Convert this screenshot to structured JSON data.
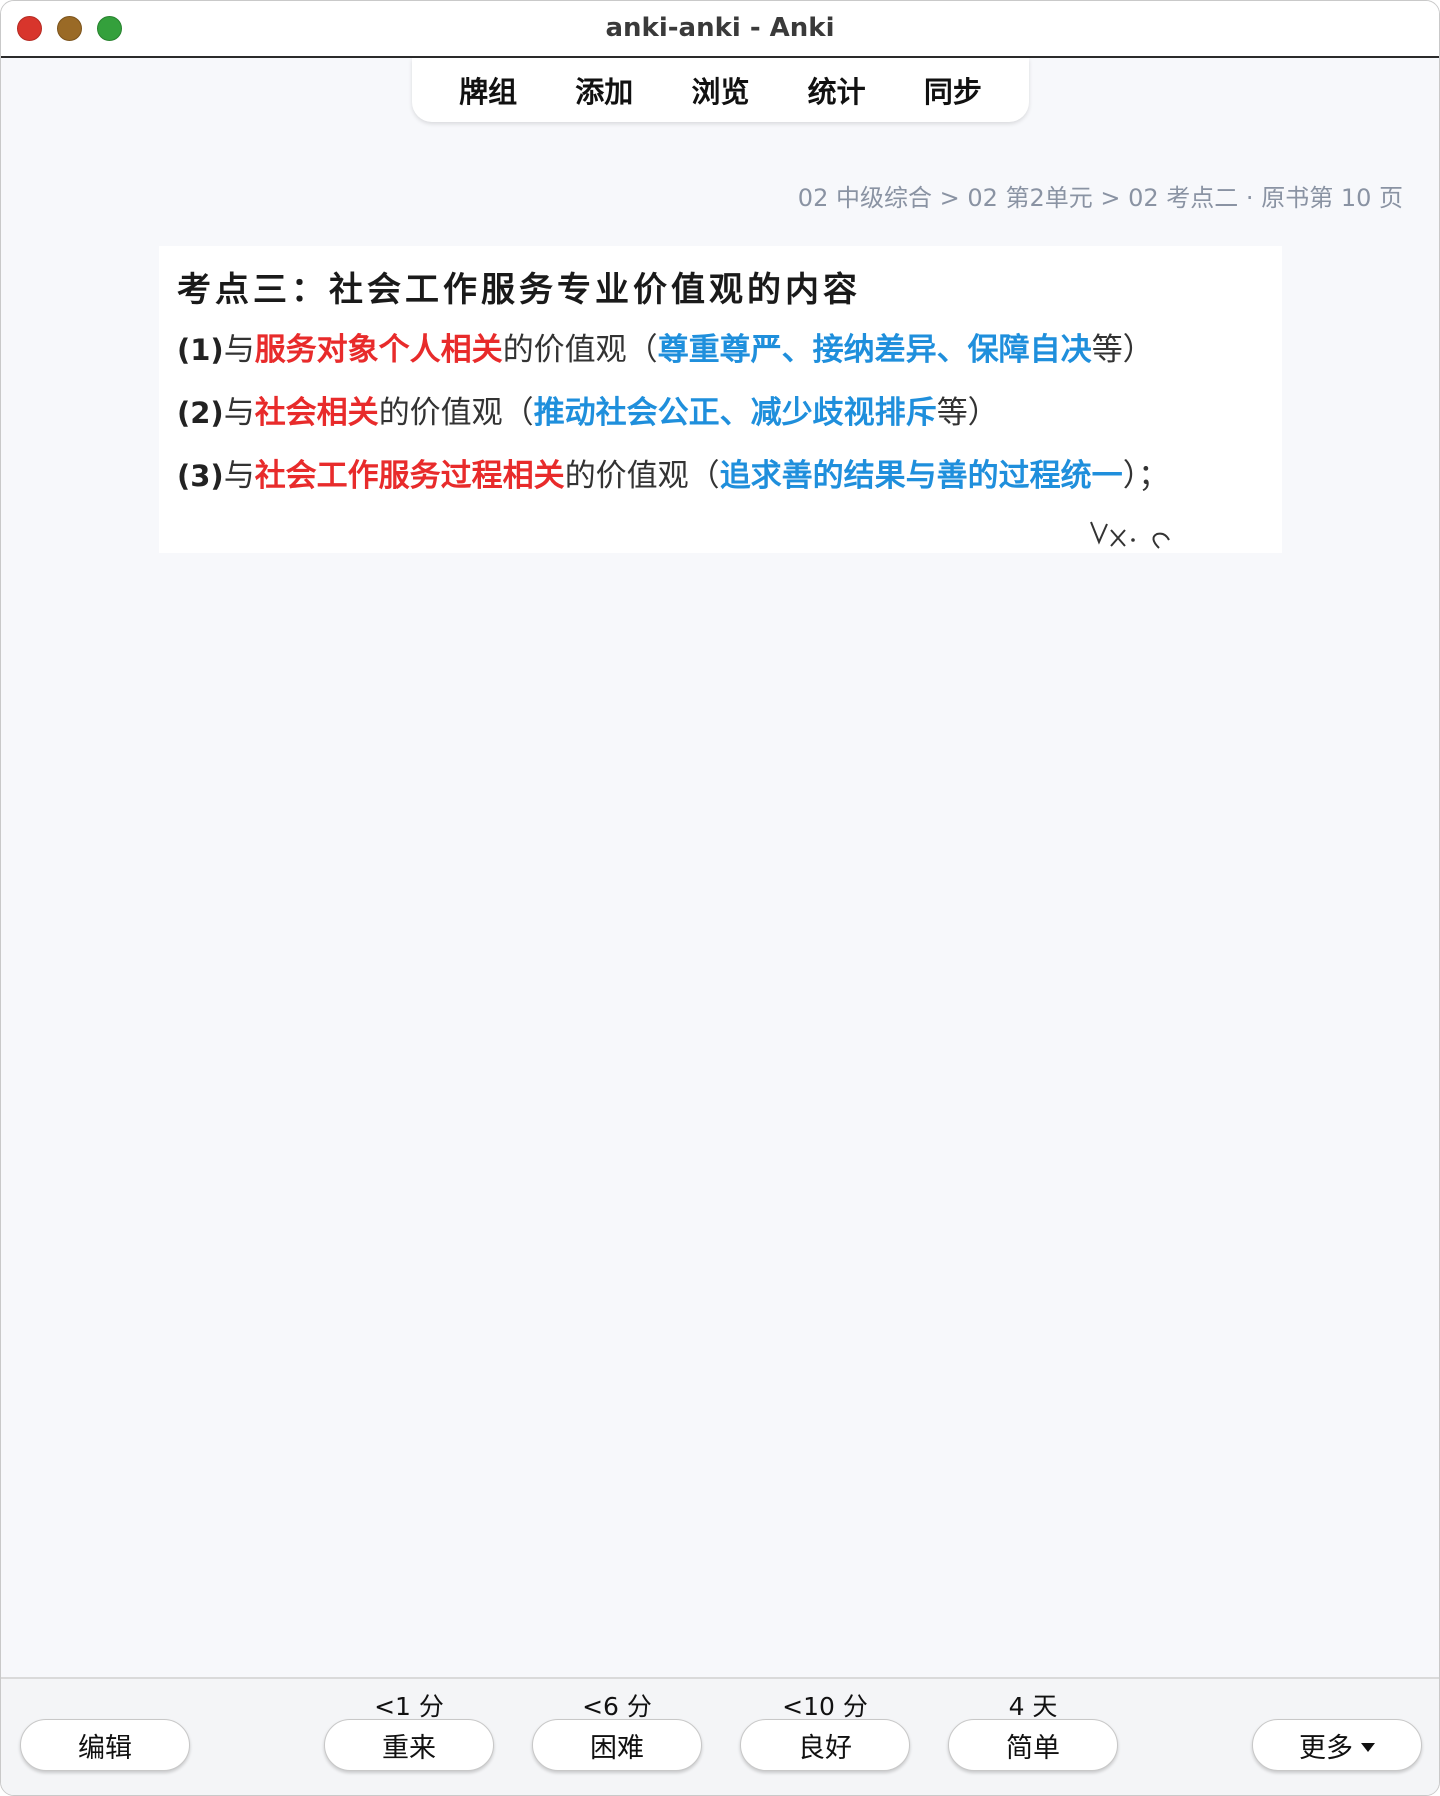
{
  "window": {
    "title": "anki-anki - Anki"
  },
  "toolbar": {
    "items": [
      {
        "label": "牌组"
      },
      {
        "label": "添加"
      },
      {
        "label": "浏览"
      },
      {
        "label": "统计"
      },
      {
        "label": "同步"
      }
    ]
  },
  "breadcrumb": "02 中级综合 > 02 第2单元 > 02 考点二 · 原书第 10 页",
  "card": {
    "title": "考点三：社会工作服务专业价值观的内容",
    "lines": [
      {
        "num": "(1)",
        "p1": "与",
        "red": "服务对象个人相关",
        "p2": "的价值观（",
        "blue": "尊重尊严、接纳差异、保障自决",
        "p3": "等）"
      },
      {
        "num": "(2)",
        "p1": "与",
        "red": "社会相关",
        "p2": "的价值观（",
        "blue": "推动社会公正、减少歧视排斥",
        "p3": "等）"
      },
      {
        "num": "(3)",
        "p1": "与",
        "red": "社会工作服务过程相关",
        "p2": "的价值观（",
        "blue": "追求善的结果与善的过程统一",
        "p3": "）；"
      }
    ],
    "watermark": "vx: c"
  },
  "bottom": {
    "edit_label": "编辑",
    "more_label": "更多",
    "answers": [
      {
        "interval": "<1 分",
        "label": "重来"
      },
      {
        "interval": "<6 分",
        "label": "困难"
      },
      {
        "interval": "<10 分",
        "label": "良好"
      },
      {
        "interval": "4 天",
        "label": "简单"
      }
    ]
  },
  "colors": {
    "red_text": "#e82b2b",
    "blue_text": "#1f8fdc",
    "breadcrumb": "#8a93a3",
    "close": "#d8352c",
    "minimize": "#9a6a26",
    "maximize": "#34a03c"
  }
}
